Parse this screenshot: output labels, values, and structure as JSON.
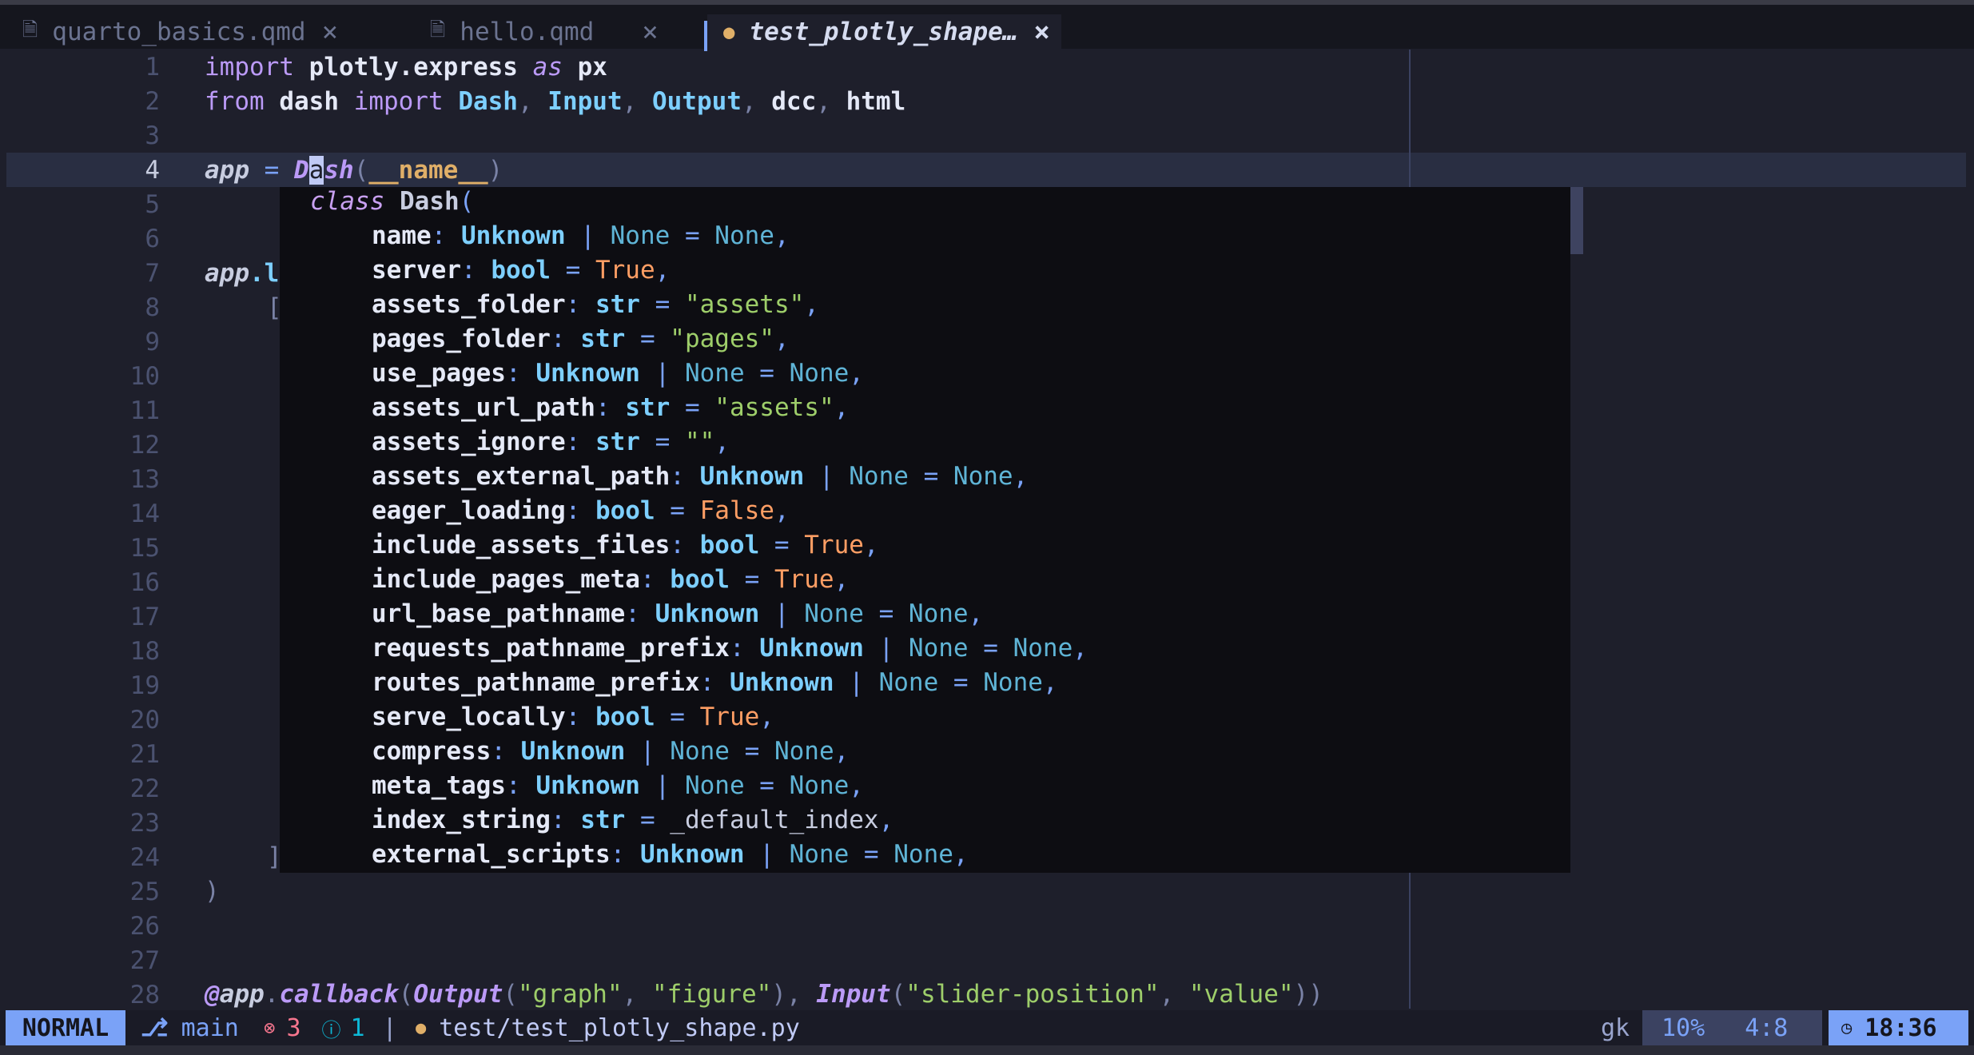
{
  "tabs": [
    {
      "label": "quarto_basics.qmd",
      "icon": "document-icon",
      "active": false
    },
    {
      "label": "hello.qmd",
      "icon": "document-icon",
      "active": false
    },
    {
      "label": "test_plotly_shape…",
      "icon": "python-icon",
      "active": true
    }
  ],
  "close_glyph": "×",
  "line_numbers": [
    "1",
    "2",
    "3",
    "4",
    "5",
    "6",
    "7",
    "8",
    "9",
    "10",
    "11",
    "12",
    "13",
    "14",
    "15",
    "16",
    "17",
    "18",
    "19",
    "20",
    "21",
    "22",
    "23",
    "24",
    "25",
    "26",
    "27",
    "28"
  ],
  "code": {
    "l1": [
      "import",
      "plotly.express",
      "as",
      "px"
    ],
    "l2": [
      "from",
      "dash",
      "import",
      "Dash",
      "Input",
      "Output",
      "dcc",
      "html"
    ],
    "l4": [
      "app",
      "=",
      "D",
      "a",
      "sh",
      "(",
      "__name__",
      ")"
    ],
    "l7": [
      "app",
      ".l"
    ],
    "l8": "[",
    "l24": "]",
    "l25": ")",
    "l28": [
      "@",
      "app",
      ".",
      "callback",
      "(",
      "Output",
      "(",
      "\"graph\"",
      ", ",
      "\"figure\"",
      "), ",
      "Input",
      "(",
      "\"slider-position\"",
      ", ",
      "\"value\"",
      "))"
    ]
  },
  "hover": {
    "keyword": "class",
    "class_name": "Dash",
    "open_paren": "(",
    "params": [
      {
        "name": "name",
        "type": "Unknown",
        "union": "None",
        "default": "None",
        "dkind": "none"
      },
      {
        "name": "server",
        "type": "bool",
        "union": "",
        "default": "True",
        "dkind": "bool"
      },
      {
        "name": "assets_folder",
        "type": "str",
        "union": "",
        "default": "\"assets\"",
        "dkind": "str"
      },
      {
        "name": "pages_folder",
        "type": "str",
        "union": "",
        "default": "\"pages\"",
        "dkind": "str"
      },
      {
        "name": "use_pages",
        "type": "Unknown",
        "union": "None",
        "default": "None",
        "dkind": "none"
      },
      {
        "name": "assets_url_path",
        "type": "str",
        "union": "",
        "default": "\"assets\"",
        "dkind": "str"
      },
      {
        "name": "assets_ignore",
        "type": "str",
        "union": "",
        "default": "\"\"",
        "dkind": "str"
      },
      {
        "name": "assets_external_path",
        "type": "Unknown",
        "union": "None",
        "default": "None",
        "dkind": "none"
      },
      {
        "name": "eager_loading",
        "type": "bool",
        "union": "",
        "default": "False",
        "dkind": "bool"
      },
      {
        "name": "include_assets_files",
        "type": "bool",
        "union": "",
        "default": "True",
        "dkind": "bool"
      },
      {
        "name": "include_pages_meta",
        "type": "bool",
        "union": "",
        "default": "True",
        "dkind": "bool"
      },
      {
        "name": "url_base_pathname",
        "type": "Unknown",
        "union": "None",
        "default": "None",
        "dkind": "none"
      },
      {
        "name": "requests_pathname_prefix",
        "type": "Unknown",
        "union": "None",
        "default": "None",
        "dkind": "none"
      },
      {
        "name": "routes_pathname_prefix",
        "type": "Unknown",
        "union": "None",
        "default": "None",
        "dkind": "none"
      },
      {
        "name": "serve_locally",
        "type": "bool",
        "union": "",
        "default": "True",
        "dkind": "bool"
      },
      {
        "name": "compress",
        "type": "Unknown",
        "union": "None",
        "default": "None",
        "dkind": "none"
      },
      {
        "name": "meta_tags",
        "type": "Unknown",
        "union": "None",
        "default": "None",
        "dkind": "none"
      },
      {
        "name": "index_string",
        "type": "str",
        "union": "",
        "default": "_default_index",
        "dkind": "plain"
      },
      {
        "name": "external_scripts",
        "type": "Unknown",
        "union": "None",
        "default": "None",
        "dkind": "none"
      }
    ]
  },
  "statusline": {
    "mode": "NORMAL",
    "branch_icon": "git-branch-icon",
    "branch": "main",
    "errors": "3",
    "info": "1",
    "separator": "|",
    "file_icon": "python-icon",
    "filename": "test/test_plotly_shape.py",
    "user": "gk",
    "percent": "10%",
    "position": "4:8",
    "clock_icon": "clock-icon",
    "time": "18:36"
  },
  "colors": {
    "background": "#1e1f2b",
    "accent": "#7aa2f7",
    "error": "#f7768e",
    "info": "#0db9d7",
    "python_icon": "#e0af68"
  }
}
